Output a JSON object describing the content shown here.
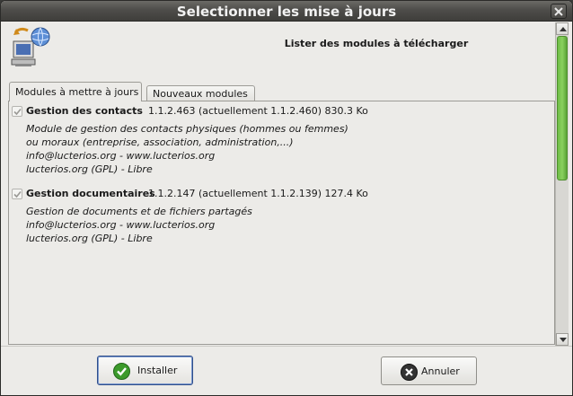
{
  "window": {
    "title": "Selectionner les mise à jours"
  },
  "header": {
    "text": "Lister des modules à télécharger"
  },
  "tabs": [
    {
      "label": "Modules à mettre à jours",
      "active": true
    },
    {
      "label": "Nouveaux modules",
      "active": false
    }
  ],
  "modules": [
    {
      "checked": true,
      "name": "Gestion des contacts",
      "version": "1.1.2.463 (actuellement 1.1.2.460) 830.3 Ko",
      "desc": [
        "Module de gestion des contacts physiques (hommes ou femmes)",
        "ou moraux (entreprise, association, administration,...)",
        "info@lucterios.org - www.lucterios.org",
        "lucterios.org (GPL) - Libre"
      ]
    },
    {
      "checked": true,
      "name": "Gestion documentaires",
      "version": "1.1.2.147 (actuellement 1.1.2.139) 127.4 Ko",
      "desc": [
        "Gestion de documents et de fichiers partagés",
        "info@lucterios.org - www.lucterios.org",
        "lucterios.org (GPL) - Libre"
      ]
    }
  ],
  "buttons": {
    "install_label": "Installer",
    "cancel_label": "Annuler"
  },
  "colors": {
    "scroll_thumb": "#6dbd46",
    "install_icon": "#3c9a2b",
    "cancel_icon": "#333333"
  }
}
